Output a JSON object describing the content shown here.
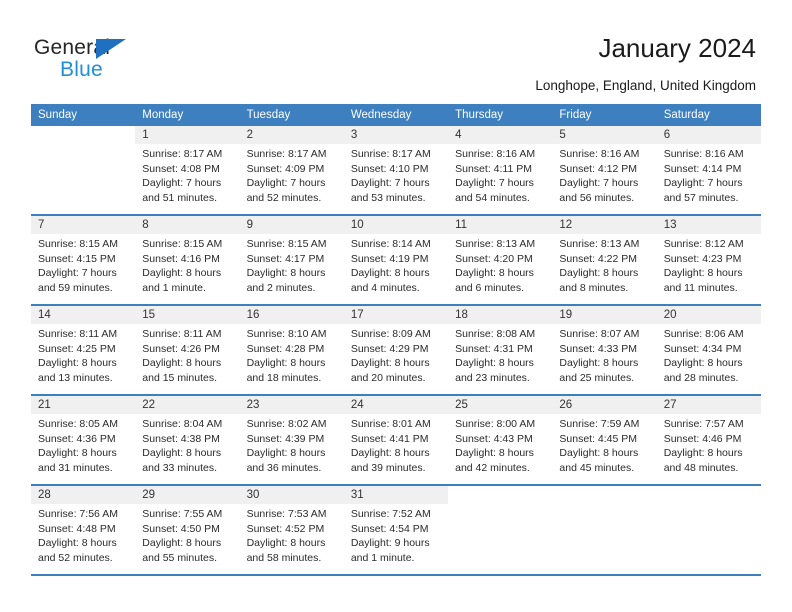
{
  "brand": {
    "name_part1": "General",
    "name_part2": "Blue",
    "triangle_color": "#1f70c1",
    "blue_color": "#1f8fd6"
  },
  "header": {
    "title": "January 2024",
    "subtitle": "Longhope, England, United Kingdom"
  },
  "theme": {
    "header_blue": "#3d7fbf",
    "day_band_gray": "#f0f0f0"
  },
  "calendar": {
    "weekdays": [
      "Sunday",
      "Monday",
      "Tuesday",
      "Wednesday",
      "Thursday",
      "Friday",
      "Saturday"
    ],
    "weeks": [
      [
        {
          "day": "",
          "sunrise": "",
          "sunset": "",
          "daylight_line1": "",
          "daylight_line2": ""
        },
        {
          "day": "1",
          "sunrise": "Sunrise: 8:17 AM",
          "sunset": "Sunset: 4:08 PM",
          "daylight_line1": "Daylight: 7 hours",
          "daylight_line2": "and 51 minutes."
        },
        {
          "day": "2",
          "sunrise": "Sunrise: 8:17 AM",
          "sunset": "Sunset: 4:09 PM",
          "daylight_line1": "Daylight: 7 hours",
          "daylight_line2": "and 52 minutes."
        },
        {
          "day": "3",
          "sunrise": "Sunrise: 8:17 AM",
          "sunset": "Sunset: 4:10 PM",
          "daylight_line1": "Daylight: 7 hours",
          "daylight_line2": "and 53 minutes."
        },
        {
          "day": "4",
          "sunrise": "Sunrise: 8:16 AM",
          "sunset": "Sunset: 4:11 PM",
          "daylight_line1": "Daylight: 7 hours",
          "daylight_line2": "and 54 minutes."
        },
        {
          "day": "5",
          "sunrise": "Sunrise: 8:16 AM",
          "sunset": "Sunset: 4:12 PM",
          "daylight_line1": "Daylight: 7 hours",
          "daylight_line2": "and 56 minutes."
        },
        {
          "day": "6",
          "sunrise": "Sunrise: 8:16 AM",
          "sunset": "Sunset: 4:14 PM",
          "daylight_line1": "Daylight: 7 hours",
          "daylight_line2": "and 57 minutes."
        }
      ],
      [
        {
          "day": "7",
          "sunrise": "Sunrise: 8:15 AM",
          "sunset": "Sunset: 4:15 PM",
          "daylight_line1": "Daylight: 7 hours",
          "daylight_line2": "and 59 minutes."
        },
        {
          "day": "8",
          "sunrise": "Sunrise: 8:15 AM",
          "sunset": "Sunset: 4:16 PM",
          "daylight_line1": "Daylight: 8 hours",
          "daylight_line2": "and 1 minute."
        },
        {
          "day": "9",
          "sunrise": "Sunrise: 8:15 AM",
          "sunset": "Sunset: 4:17 PM",
          "daylight_line1": "Daylight: 8 hours",
          "daylight_line2": "and 2 minutes."
        },
        {
          "day": "10",
          "sunrise": "Sunrise: 8:14 AM",
          "sunset": "Sunset: 4:19 PM",
          "daylight_line1": "Daylight: 8 hours",
          "daylight_line2": "and 4 minutes."
        },
        {
          "day": "11",
          "sunrise": "Sunrise: 8:13 AM",
          "sunset": "Sunset: 4:20 PM",
          "daylight_line1": "Daylight: 8 hours",
          "daylight_line2": "and 6 minutes."
        },
        {
          "day": "12",
          "sunrise": "Sunrise: 8:13 AM",
          "sunset": "Sunset: 4:22 PM",
          "daylight_line1": "Daylight: 8 hours",
          "daylight_line2": "and 8 minutes."
        },
        {
          "day": "13",
          "sunrise": "Sunrise: 8:12 AM",
          "sunset": "Sunset: 4:23 PM",
          "daylight_line1": "Daylight: 8 hours",
          "daylight_line2": "and 11 minutes."
        }
      ],
      [
        {
          "day": "14",
          "sunrise": "Sunrise: 8:11 AM",
          "sunset": "Sunset: 4:25 PM",
          "daylight_line1": "Daylight: 8 hours",
          "daylight_line2": "and 13 minutes."
        },
        {
          "day": "15",
          "sunrise": "Sunrise: 8:11 AM",
          "sunset": "Sunset: 4:26 PM",
          "daylight_line1": "Daylight: 8 hours",
          "daylight_line2": "and 15 minutes."
        },
        {
          "day": "16",
          "sunrise": "Sunrise: 8:10 AM",
          "sunset": "Sunset: 4:28 PM",
          "daylight_line1": "Daylight: 8 hours",
          "daylight_line2": "and 18 minutes."
        },
        {
          "day": "17",
          "sunrise": "Sunrise: 8:09 AM",
          "sunset": "Sunset: 4:29 PM",
          "daylight_line1": "Daylight: 8 hours",
          "daylight_line2": "and 20 minutes."
        },
        {
          "day": "18",
          "sunrise": "Sunrise: 8:08 AM",
          "sunset": "Sunset: 4:31 PM",
          "daylight_line1": "Daylight: 8 hours",
          "daylight_line2": "and 23 minutes."
        },
        {
          "day": "19",
          "sunrise": "Sunrise: 8:07 AM",
          "sunset": "Sunset: 4:33 PM",
          "daylight_line1": "Daylight: 8 hours",
          "daylight_line2": "and 25 minutes."
        },
        {
          "day": "20",
          "sunrise": "Sunrise: 8:06 AM",
          "sunset": "Sunset: 4:34 PM",
          "daylight_line1": "Daylight: 8 hours",
          "daylight_line2": "and 28 minutes."
        }
      ],
      [
        {
          "day": "21",
          "sunrise": "Sunrise: 8:05 AM",
          "sunset": "Sunset: 4:36 PM",
          "daylight_line1": "Daylight: 8 hours",
          "daylight_line2": "and 31 minutes."
        },
        {
          "day": "22",
          "sunrise": "Sunrise: 8:04 AM",
          "sunset": "Sunset: 4:38 PM",
          "daylight_line1": "Daylight: 8 hours",
          "daylight_line2": "and 33 minutes."
        },
        {
          "day": "23",
          "sunrise": "Sunrise: 8:02 AM",
          "sunset": "Sunset: 4:39 PM",
          "daylight_line1": "Daylight: 8 hours",
          "daylight_line2": "and 36 minutes."
        },
        {
          "day": "24",
          "sunrise": "Sunrise: 8:01 AM",
          "sunset": "Sunset: 4:41 PM",
          "daylight_line1": "Daylight: 8 hours",
          "daylight_line2": "and 39 minutes."
        },
        {
          "day": "25",
          "sunrise": "Sunrise: 8:00 AM",
          "sunset": "Sunset: 4:43 PM",
          "daylight_line1": "Daylight: 8 hours",
          "daylight_line2": "and 42 minutes."
        },
        {
          "day": "26",
          "sunrise": "Sunrise: 7:59 AM",
          "sunset": "Sunset: 4:45 PM",
          "daylight_line1": "Daylight: 8 hours",
          "daylight_line2": "and 45 minutes."
        },
        {
          "day": "27",
          "sunrise": "Sunrise: 7:57 AM",
          "sunset": "Sunset: 4:46 PM",
          "daylight_line1": "Daylight: 8 hours",
          "daylight_line2": "and 48 minutes."
        }
      ],
      [
        {
          "day": "28",
          "sunrise": "Sunrise: 7:56 AM",
          "sunset": "Sunset: 4:48 PM",
          "daylight_line1": "Daylight: 8 hours",
          "daylight_line2": "and 52 minutes."
        },
        {
          "day": "29",
          "sunrise": "Sunrise: 7:55 AM",
          "sunset": "Sunset: 4:50 PM",
          "daylight_line1": "Daylight: 8 hours",
          "daylight_line2": "and 55 minutes."
        },
        {
          "day": "30",
          "sunrise": "Sunrise: 7:53 AM",
          "sunset": "Sunset: 4:52 PM",
          "daylight_line1": "Daylight: 8 hours",
          "daylight_line2": "and 58 minutes."
        },
        {
          "day": "31",
          "sunrise": "Sunrise: 7:52 AM",
          "sunset": "Sunset: 4:54 PM",
          "daylight_line1": "Daylight: 9 hours",
          "daylight_line2": "and 1 minute."
        },
        {
          "day": "",
          "sunrise": "",
          "sunset": "",
          "daylight_line1": "",
          "daylight_line2": ""
        },
        {
          "day": "",
          "sunrise": "",
          "sunset": "",
          "daylight_line1": "",
          "daylight_line2": ""
        },
        {
          "day": "",
          "sunrise": "",
          "sunset": "",
          "daylight_line1": "",
          "daylight_line2": ""
        }
      ]
    ]
  }
}
